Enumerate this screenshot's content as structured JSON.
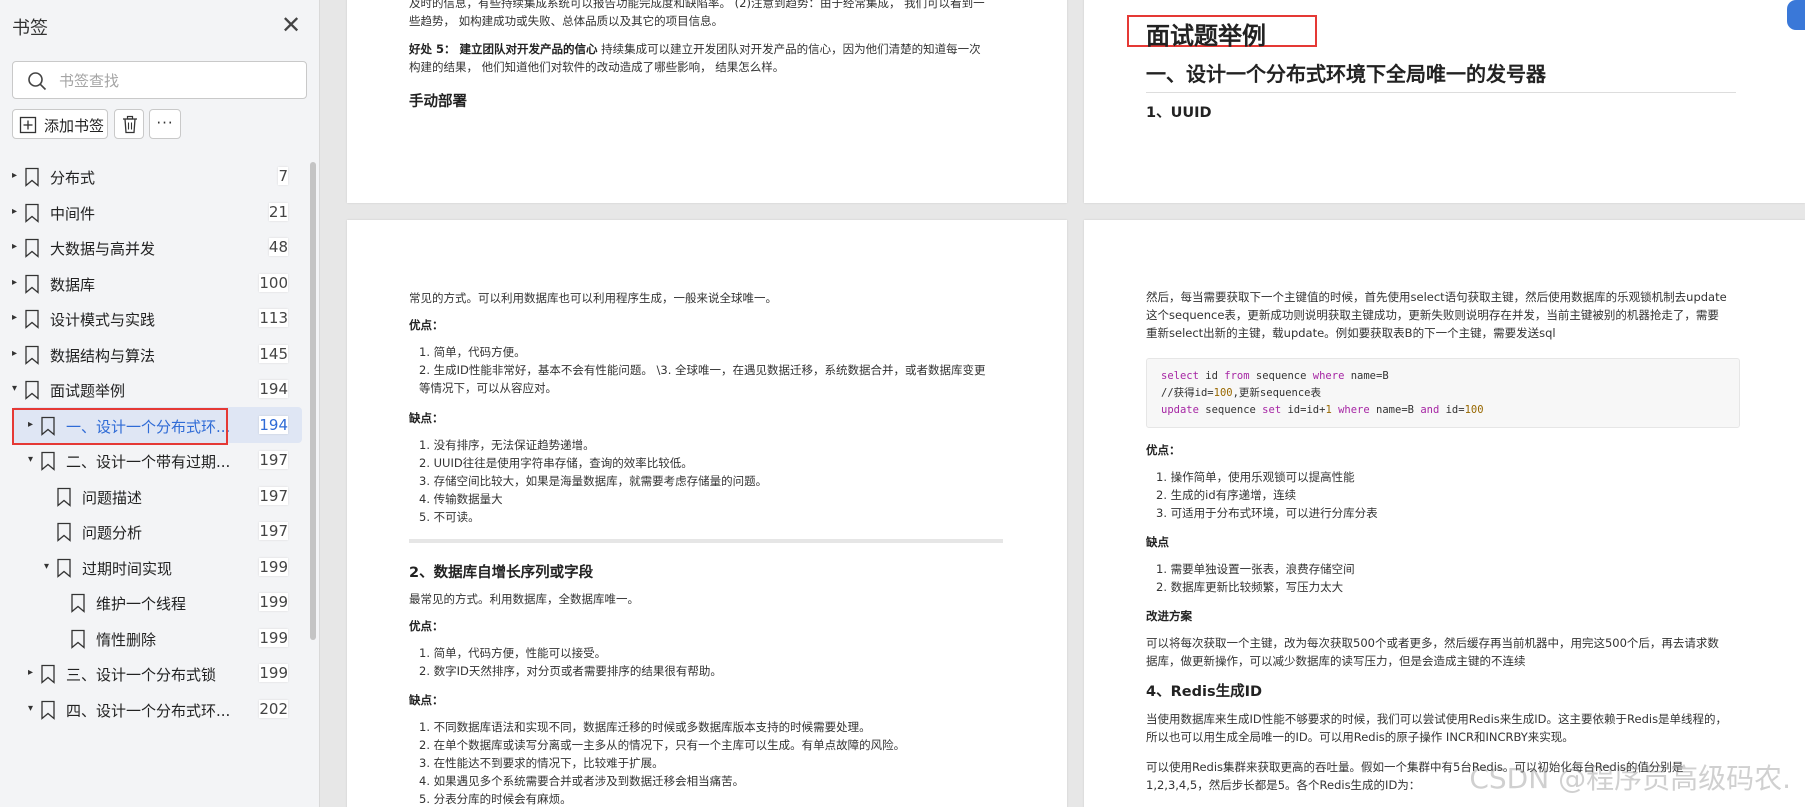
{
  "sidebar": {
    "title": "书签",
    "search_placeholder": "书签查找",
    "add_bookmark_label": "添加书签",
    "more_label": "···",
    "items": [
      {
        "label": "分布式",
        "page": "7",
        "level": 0,
        "caret": "▸"
      },
      {
        "label": "中间件",
        "page": "21",
        "level": 0,
        "caret": "▸"
      },
      {
        "label": "大数据与高并发",
        "page": "48",
        "level": 0,
        "caret": "▸"
      },
      {
        "label": "数据库",
        "page": "100",
        "level": 0,
        "caret": "▸"
      },
      {
        "label": "设计模式与实践",
        "page": "113",
        "level": 0,
        "caret": "▸"
      },
      {
        "label": "数据结构与算法",
        "page": "145",
        "level": 0,
        "caret": "▸"
      },
      {
        "label": "面试题举例",
        "page": "194",
        "level": 0,
        "caret": "▾"
      },
      {
        "label": "一、设计一个分布式环...",
        "page": "194",
        "level": 1,
        "caret": "▸"
      },
      {
        "label": "二、设计一个带有过期...",
        "page": "197",
        "level": 1,
        "caret": "▾"
      },
      {
        "label": "问题描述",
        "page": "197",
        "level": 2,
        "caret": ""
      },
      {
        "label": "问题分析",
        "page": "197",
        "level": 2,
        "caret": ""
      },
      {
        "label": "过期时间实现",
        "page": "199",
        "level": 2,
        "caret": "▾"
      },
      {
        "label": "维护一个线程",
        "page": "199",
        "level": 3,
        "caret": ""
      },
      {
        "label": "惰性删除",
        "page": "199",
        "level": 3,
        "caret": ""
      },
      {
        "label": "三、设计一个分布式锁",
        "page": "199",
        "level": 1,
        "caret": "▸"
      },
      {
        "label": "四、设计一个分布式环...",
        "page": "202",
        "level": 1,
        "caret": "▾"
      }
    ]
  },
  "page1": {
    "line1": "及时的信息，有些持续集成系统可以报告功能完成度和缺陷率。 (2)注意到趋势：由于经常集成， 我们可以看到一",
    "line2": "些趋势， 如构建成功或失败、总体品质以及其它的项目信息。",
    "benefit5_title": "好处 5： 建立团队对开发产品的信心",
    "benefit5_text": " 持续集成可以建立开发团队对开发产品的信心，因为他们清楚的知道每一次",
    "benefit5_line2": "构建的结果， 他们知道他们对软件的改动造成了哪些影响， 结果怎么样。",
    "heading": "手动部署"
  },
  "page2": {
    "title": "面试题举例",
    "h1": "一、设计一个分布式环境下全局唯一的发号器",
    "h3": "1、UUID"
  },
  "page3": {
    "intro": "常见的方式。可以利用数据库也可以利用程序生成，一般来说全球唯一。",
    "pros_label": "优点：",
    "pros": [
      "1. 简单，代码方便。",
      "2. 生成ID性能非常好，基本不会有性能问题。 \\3. 全球唯一，在遇见数据迁移，系统数据合并，或者数据库变更",
      "    等情况下，可以从容应对。"
    ],
    "cons_label": "缺点：",
    "cons": [
      "1. 没有排序，无法保证趋势递增。",
      "2. UUID往往是使用字符串存储，查询的效率比较低。",
      "3. 存储空间比较大，如果是海量数据库，就需要考虑存储量的问题。",
      "4. 传输数据量大",
      "5. 不可读。"
    ],
    "section2_title": "2、数据库自增长序列或字段",
    "section2_intro": "最常见的方式。利用数据库，全数据库唯一。",
    "pros2_label": "优点：",
    "pros2": [
      "1. 简单，代码方便，性能可以接受。",
      "2. 数字ID天然排序，对分页或者需要排序的结果很有帮助。"
    ],
    "cons2_label": "缺点：",
    "cons2": [
      "1. 不同数据库语法和实现不同，数据库迁移的时候或多数据库版本支持的时候需要处理。",
      "2. 在单个数据库或读写分离或一主多从的情况下，只有一个主库可以生成。有单点故障的风险。",
      "3. 在性能达不到要求的情况下，比较难于扩展。",
      "4. 如果遇见多个系统需要合并或者涉及到数据迁移会相当痛苦。",
      "5. 分表分库的时候会有麻烦。"
    ]
  },
  "page4": {
    "para1": [
      "然后，每当需要获取下一个主键值的时候，首先使用select语句获取主键，然后使用数据库的乐观锁机制去update",
      "这个sequence表，更新成功则说明获取主键成功，更新失败则说明存在并发，当前主键被别的机器抢走了，需要",
      "重新select出新的主键，载update。例如要获取表B的下一个主键，需要发送sql"
    ],
    "code": [
      "select id from sequence where name=B",
      "//获得id=100,更新sequence表",
      "update sequence set id=id+1 where name=B and id=100"
    ],
    "pros_label": "优点：",
    "pros": [
      "1. 操作简单，使用乐观锁可以提高性能",
      "2. 生成的id有序递增，连续",
      "3. 可适用于分布式环境，可以进行分库分表"
    ],
    "cons_label": "缺点",
    "cons": [
      "1. 需要单独设置一张表，浪费存储空间",
      "2. 数据库更新比较频繁，写压力太大"
    ],
    "improve_label": "改进方案",
    "improve": [
      "可以将每次获取一个主键，改为每次获取500个或者更多，然后缓存再当前机器中，用完这500个后，再去请求数",
      "据库，做更新操作，可以减少数据库的读写压力，但是会造成主键的不连续"
    ],
    "section4_title": "4、Redis生成ID",
    "section4": [
      "当使用数据库来生成ID性能不够要求的时候，我们可以尝试使用Redis来生成ID。这主要依赖于Redis是单线程的，",
      "所以也可以用生成全局唯一的ID。可以用Redis的原子操作 INCR和INCRBY来实现。"
    ],
    "section4b": [
      "可以使用Redis集群来获取更高的吞吐量。假如一个集群中有5台Redis。可以初始化每台Redis的值分别是",
      "1,2,3,4,5，然后步长都是5。各个Redis生成的ID为："
    ]
  },
  "watermark": "CSDN @程序员高级码农."
}
